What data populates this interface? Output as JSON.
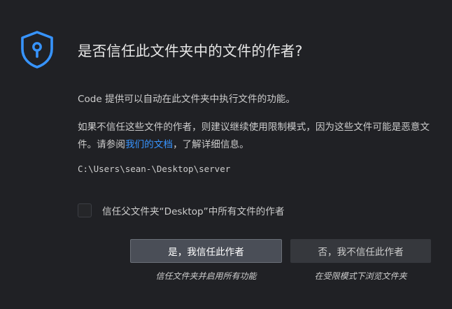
{
  "dialog": {
    "icon": "shield-lock-icon",
    "accent_color": "#3794ff",
    "title": "是否信任此文件夹中的文件的作者?",
    "paragraph1": "Code 提供可以自动在此文件夹中执行文件的功能。",
    "paragraph2_before": "如果不信任这些文件的作者，则建议继续使用限制模式，因为这些文件可能是恶意文件。请参阅",
    "paragraph2_link": "我们的文档",
    "paragraph2_after": "，了解详细信息。",
    "folder_path": "C:\\Users\\sean-\\Desktop\\server",
    "checkbox_label": "信任父文件夹“Desktop”中所有文件的作者",
    "checkbox_checked": false,
    "trust_button": "是，我信任此作者",
    "trust_caption": "信任文件夹并启用所有功能",
    "notrust_button": "否，我不信任此作者",
    "notrust_caption": "在受限模式下浏览文件夹"
  }
}
